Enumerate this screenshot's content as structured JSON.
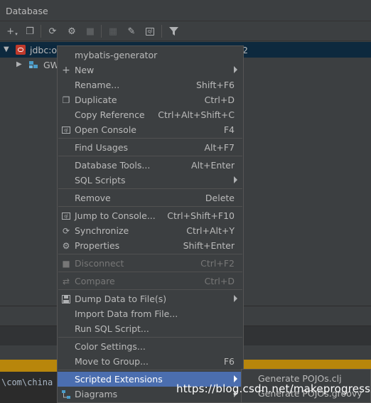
{
  "panel": {
    "title": "Database"
  },
  "toolbar": {
    "buttons": [
      {
        "name": "add-icon",
        "glyph": "+"
      },
      {
        "name": "copy-icon",
        "glyph": "❐"
      },
      {
        "name": "refresh-icon",
        "glyph": "⟳"
      },
      {
        "name": "properties-icon",
        "glyph": "⚙"
      },
      {
        "name": "stop-icon",
        "glyph": "■"
      },
      {
        "name": "table-icon",
        "glyph": "▦"
      },
      {
        "name": "edit-icon",
        "glyph": "✎"
      },
      {
        "name": "console-icon",
        "glyph": "▣"
      },
      {
        "name": "filter-icon",
        "glyph": "▼"
      }
    ]
  },
  "tree": {
    "datasource_label": "jdbc:or",
    "datasource_suffix": "2",
    "schema_label": "GW"
  },
  "menu": {
    "header": "mybatis-generator",
    "items": [
      {
        "label": "New",
        "shortcut": "",
        "submenu": true,
        "icon": "plus-icon"
      },
      {
        "label": "Rename...",
        "shortcut": "Shift+F6"
      },
      {
        "label": "Duplicate",
        "shortcut": "Ctrl+D",
        "icon": "duplicate-icon"
      },
      {
        "label": "Copy Reference",
        "shortcut": "Ctrl+Alt+Shift+C"
      },
      {
        "label": "Open Console",
        "shortcut": "F4",
        "icon": "console-icon"
      },
      {
        "label": "Find Usages",
        "shortcut": "Alt+F7"
      },
      {
        "label": "Database Tools...",
        "shortcut": "Alt+Enter"
      },
      {
        "label": "SQL Scripts",
        "shortcut": "",
        "submenu": true
      },
      {
        "label": "Remove",
        "shortcut": "Delete"
      },
      {
        "label": "Jump to Console...",
        "shortcut": "Ctrl+Shift+F10",
        "icon": "console-icon"
      },
      {
        "label": "Synchronize",
        "shortcut": "Ctrl+Alt+Y",
        "icon": "refresh-icon"
      },
      {
        "label": "Properties",
        "shortcut": "Shift+Enter",
        "icon": "properties-icon"
      },
      {
        "label": "Disconnect",
        "shortcut": "Ctrl+F2",
        "icon": "stop-icon",
        "disabled": true
      },
      {
        "label": "Compare",
        "shortcut": "Ctrl+D",
        "icon": "compare-icon",
        "disabled": true
      },
      {
        "label": "Dump Data to File(s)",
        "shortcut": "",
        "submenu": true,
        "icon": "save-icon"
      },
      {
        "label": "Import Data from File...",
        "shortcut": ""
      },
      {
        "label": "Run SQL Script...",
        "shortcut": ""
      },
      {
        "label": "Color Settings...",
        "shortcut": ""
      },
      {
        "label": "Move to Group...",
        "shortcut": "F6"
      },
      {
        "label": "Scripted Extensions",
        "shortcut": "",
        "submenu": true,
        "highlight": true
      },
      {
        "label": "Diagrams",
        "shortcut": "",
        "submenu": true,
        "icon": "diagram-icon"
      }
    ]
  },
  "submenu": {
    "items": [
      "Generate POJOs.clj",
      "Generate POJOs.groovy"
    ]
  },
  "console": {
    "text": "\\com\\china"
  },
  "watermark": "https://blog.csdn.net/makeprogresszb"
}
